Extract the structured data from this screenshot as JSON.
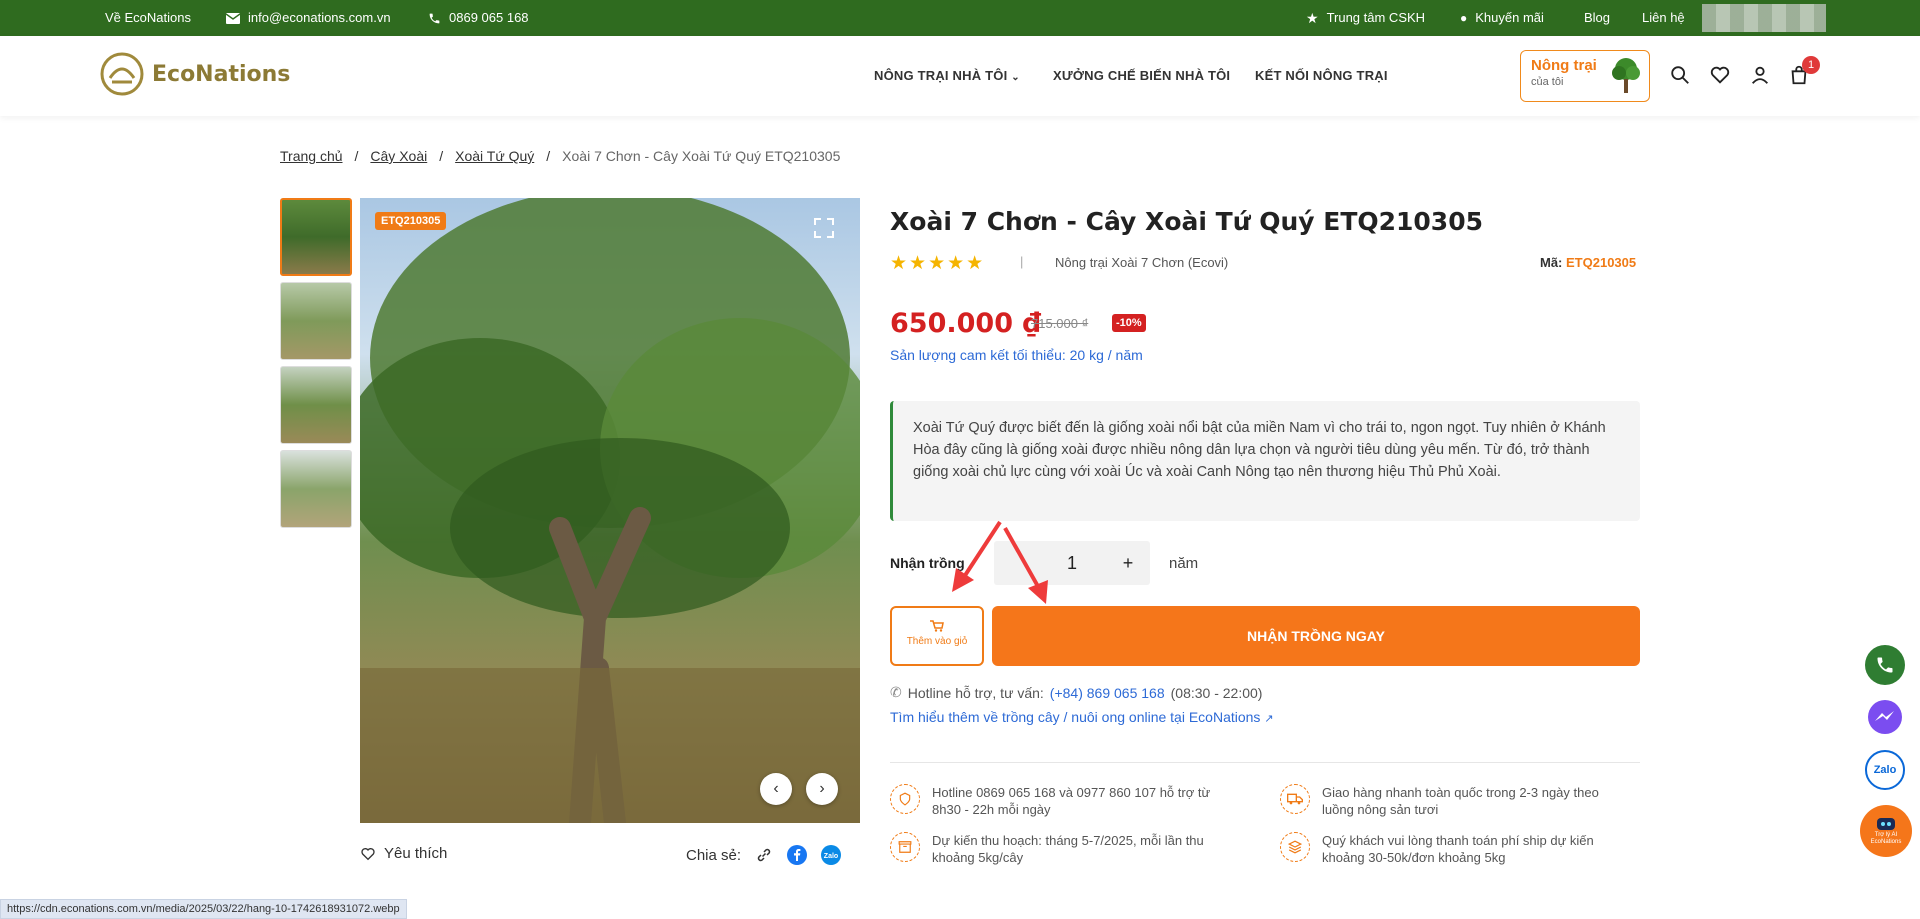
{
  "topbar": {
    "about": "Về EcoNations",
    "email": "info@econations.com.vn",
    "phone": "0869 065 168",
    "support": "Trung tâm CSKH",
    "promo": "Khuyến mãi",
    "blog": "Blog",
    "contact": "Liên hệ"
  },
  "header": {
    "logo": "EcoNations",
    "nav": [
      "NÔNG TRẠI NHÀ TÔI",
      "XƯỞNG CHẾ BIẾN NHÀ TÔI",
      "KẾT NỐI NÔNG TRẠI"
    ],
    "farm_title": "Nông trại",
    "farm_sub": "của tôi",
    "cart_count": "1"
  },
  "breadcrumb": {
    "home": "Trang chủ",
    "cat1": "Cây Xoài",
    "cat2": "Xoài Tứ Quý",
    "current": "Xoài 7 Chơn - Cây Xoài Tứ Quý ETQ210305"
  },
  "gallery": {
    "code_tag": "ETQ210305",
    "favorite": "Yêu thích",
    "share": "Chia sẻ:"
  },
  "product": {
    "title": "Xoài 7 Chơn - Cây Xoài Tứ Quý ETQ210305",
    "rating": 5,
    "farm": "Nông trại Xoài 7 Chơn (Ecovi)",
    "sku_label": "Mã:",
    "sku": "ETQ210305",
    "price": "650.000 ₫",
    "old_price": "715.000 ₫",
    "discount": "-10%",
    "commitment": "Sản lượng cam kết tối thiểu: 20 kg / năm",
    "description": "Xoài Tứ Quý được biết đến là giống xoài nổi bật của miền Nam vì cho trái to, ngon ngọt. Tuy nhiên ở Khánh Hòa đây cũng là giống xoài được nhiều nông dân lựa chọn và người tiêu dùng yêu mến. Từ đó, trở thành giống xoài chủ lực cùng với xoài Úc và xoài Canh Nông tạo nên thương hiệu Thủ Phủ Xoài.",
    "qty_label": "Nhận trồng",
    "qty_value": "1",
    "qty_plus": "+",
    "qty_unit": "năm",
    "add_cart": "Thêm vào giỏ",
    "buy_now": "NHẬN TRỒNG NGAY",
    "hotline_label": "Hotline hỗ trợ, tư vấn:",
    "hotline_number": "(+84) 869 065 168",
    "hotline_hours": "(08:30 - 22:00)",
    "learn_more": "Tìm hiểu thêm về trồng cây / nuôi ong online tại EcoNations"
  },
  "features": [
    "Hotline 0869 065 168 và 0977 860 107 hỗ trợ từ 8h30 - 22h mỗi ngày",
    "Giao hàng nhanh toàn quốc trong 2-3 ngày theo luồng nông sản tươi",
    "Dự kiến thu hoạch: tháng 5-7/2025, mỗi lần thu khoảng 5kg/cây",
    "Quý khách vui lòng thanh toán phí ship dự kiến khoảng 30-50k/đơn khoảng 5kg"
  ],
  "side": {
    "zalo": "Zalo",
    "ai": "Trợ lý AI EcoNations"
  },
  "statusbar": "https://cdn.econations.com.vn/media/2025/03/22/hang-10-1742618931072.webp",
  "colors": {
    "topbar": "#2f6b1f",
    "accent": "#f5761a",
    "price": "#d42121",
    "link": "#2d6ad6"
  }
}
